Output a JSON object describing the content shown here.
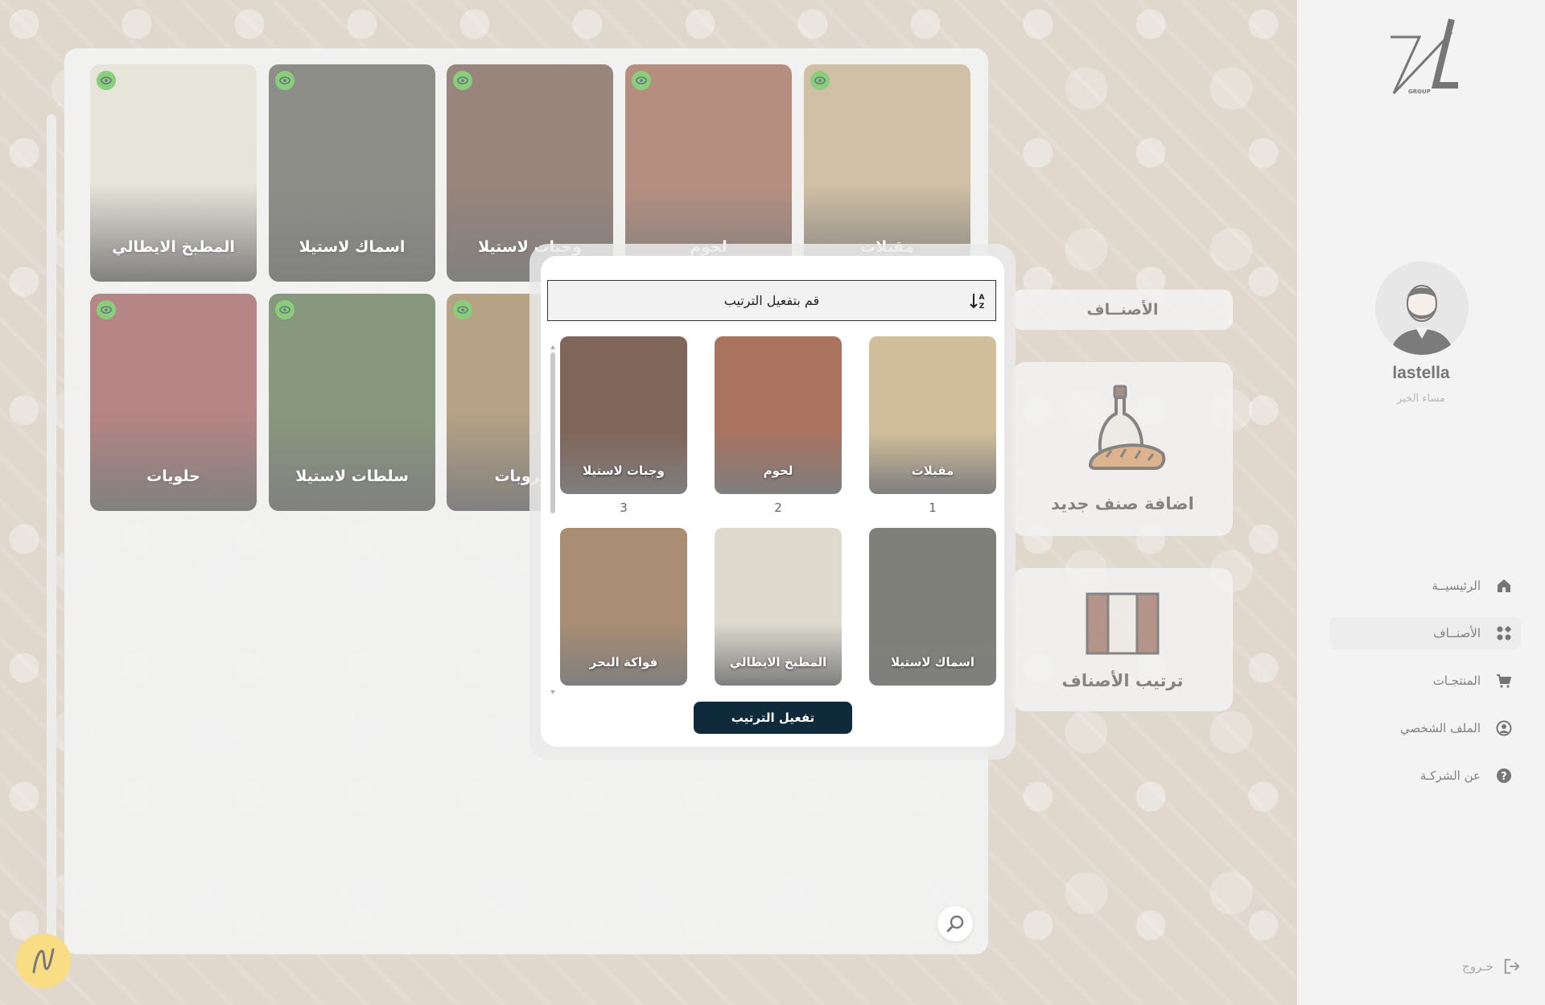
{
  "sidebar": {
    "logo_text": "GROUP",
    "user_name": "lastella",
    "greeting": "مساء الخير",
    "nav": [
      {
        "label": "الرئيسيــة",
        "icon": "home-icon"
      },
      {
        "label": "الأصنــاف",
        "icon": "categories-icon",
        "active": true
      },
      {
        "label": "المنتجـات",
        "icon": "cart-icon"
      },
      {
        "label": "الملف الشخصي",
        "icon": "profile-icon"
      },
      {
        "label": "عن الشركـة",
        "icon": "help-icon"
      }
    ],
    "logout_label": "خـروج"
  },
  "categories_panel": {
    "title": "الأصنــاف",
    "add_label": "اضافة صنف جديد",
    "order_label": "ترتيب الأصناف"
  },
  "grid": {
    "tiles": [
      {
        "label": "مقبلات",
        "color": "#b59a6e"
      },
      {
        "label": "لحوم",
        "color": "#8a4a32"
      },
      {
        "label": "وجبات لاستيلا",
        "color": "#5a3a2c"
      },
      {
        "label": "اسماك لاستيلا",
        "color": "#4a4a42"
      },
      {
        "label": "المطبخ الايطالي",
        "color": "#d9d4c2"
      },
      {
        "label": "مشروبات",
        "color": "#8a6a3a"
      },
      {
        "label": "سلطات لاستيلا",
        "color": "#3f5a2c"
      },
      {
        "label": "حلويات",
        "color": "#8a3a3a"
      }
    ]
  },
  "modal": {
    "sort_prompt": "قم بتفعيل الترتيب",
    "items": [
      {
        "label": "مقبلات",
        "order": "1",
        "color": "#c9b48a"
      },
      {
        "label": "لحوم",
        "order": "2",
        "color": "#9a5a42"
      },
      {
        "label": "وجبات لاستيلا",
        "order": "3",
        "color": "#6a4a3c"
      },
      {
        "label": "اسماك لاستيلا",
        "color": "#6a6a62"
      },
      {
        "label": "المطبخ الايطالي",
        "color": "#d8d4c6"
      },
      {
        "label": "فواكة البحر",
        "color": "#9a7a5a"
      }
    ],
    "button_label": "تفعيل الترتيب"
  }
}
